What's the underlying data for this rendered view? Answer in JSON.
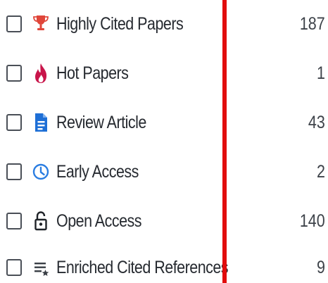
{
  "filters": [
    {
      "label": "Highly Cited Papers",
      "count": "187",
      "icon": "trophy-icon",
      "icon_color": "#e0463a"
    },
    {
      "label": "Hot Papers",
      "count": "1",
      "icon": "flame-icon",
      "icon_color": "#c8154a"
    },
    {
      "label": "Review Article",
      "count": "43",
      "icon": "document-icon",
      "icon_color": "#1e6fd6"
    },
    {
      "label": "Early Access",
      "count": "2",
      "icon": "clock-icon",
      "icon_color": "#2a7de1"
    },
    {
      "label": "Open Access",
      "count": "140",
      "icon": "unlock-icon",
      "icon_color": "#1f2328"
    },
    {
      "label": "Enriched Cited References",
      "count": "9",
      "icon": "enriched-list-icon",
      "icon_color": "#3a3f46"
    }
  ],
  "divider_color": "#e10d0d"
}
